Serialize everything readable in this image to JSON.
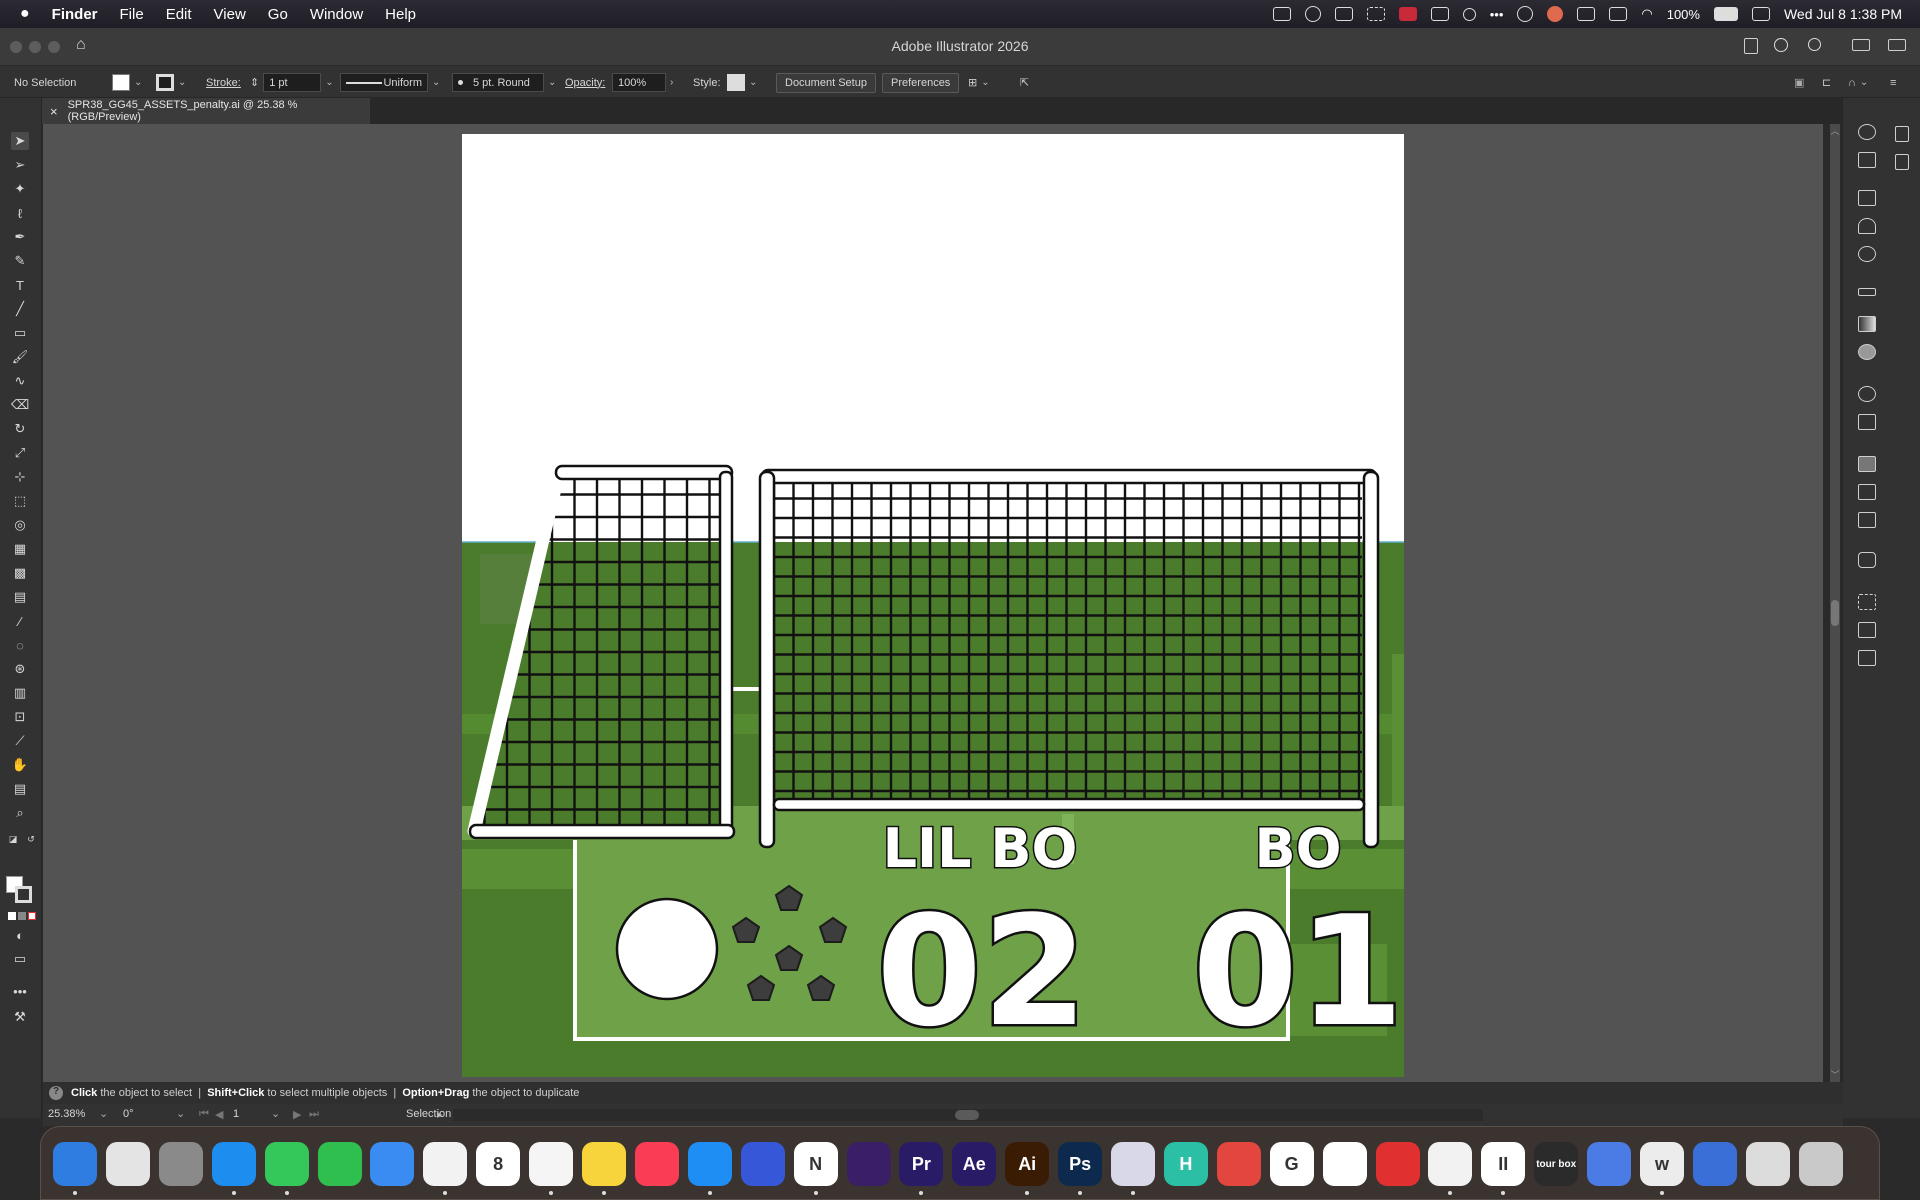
{
  "menubar": {
    "apple": "",
    "items": [
      "Finder",
      "File",
      "Edit",
      "View",
      "Go",
      "Window",
      "Help"
    ],
    "battery": "100%",
    "clock": "Wed Jul 8  1:38 PM"
  },
  "titlebar": {
    "title": "Adobe Illustrator 2026"
  },
  "controlbar": {
    "selection": "No Selection",
    "stroke_label": "Stroke:",
    "stroke_value": "1 pt",
    "profile": "Uniform",
    "brush": "5 pt. Round",
    "opacity_label": "Opacity:",
    "opacity_value": "100%",
    "style_label": "Style:",
    "document_setup": "Document Setup",
    "preferences": "Preferences"
  },
  "document": {
    "tab_title": "SPR38_GG45_ASSETS_penalty.ai @ 25.38 % (RGB/Preview)",
    "close": "×"
  },
  "artwork": {
    "team_left": "LIL BO",
    "team_right": "BO",
    "score_left": "02",
    "score_right": "01",
    "colors": {
      "field_dark": "#4a7c2c",
      "field_mid": "#5b8f36",
      "field_light": "#6fa149",
      "net_line": "#111111"
    }
  },
  "hint": {
    "a_key": "Click",
    "a_text": "the object to select",
    "b_key": "Shift+Click",
    "b_text": "to select multiple objects",
    "c_key": "Option+Drag",
    "c_text": "the object to duplicate",
    "sep": "|"
  },
  "statusbar": {
    "zoom": "25.38%",
    "rotation": "0°",
    "artboard": "1",
    "tool": "Selection"
  },
  "dock": {
    "apps": [
      {
        "name": "finder",
        "label": "",
        "color": "#2f7de0"
      },
      {
        "name": "launchpad",
        "label": "",
        "color": "#e4e4e4"
      },
      {
        "name": "system-settings",
        "label": "",
        "color": "#8a8a8a"
      },
      {
        "name": "safari",
        "label": "",
        "color": "#1d8df0"
      },
      {
        "name": "messages",
        "label": "",
        "color": "#34c759"
      },
      {
        "name": "facetime",
        "label": "",
        "color": "#2fbf4f"
      },
      {
        "name": "mail",
        "label": "",
        "color": "#3b8cf2"
      },
      {
        "name": "photos",
        "label": "",
        "color": "#f2f2f2"
      },
      {
        "name": "calendar",
        "label": "8",
        "color": "#ffffff"
      },
      {
        "name": "reminders",
        "label": "",
        "color": "#f5f5f5"
      },
      {
        "name": "notes",
        "label": "",
        "color": "#f7d43b"
      },
      {
        "name": "music",
        "label": "",
        "color": "#fb3c55"
      },
      {
        "name": "app-store",
        "label": "",
        "color": "#1e8ef5"
      },
      {
        "name": "omnifocus",
        "label": "",
        "color": "#3657d8"
      },
      {
        "name": "notion",
        "label": "N",
        "color": "#ffffff"
      },
      {
        "name": "activity",
        "label": "",
        "color": "#3a1f66"
      },
      {
        "name": "premiere",
        "label": "Pr",
        "color": "#2a1b66"
      },
      {
        "name": "after-effects",
        "label": "Ae",
        "color": "#2a1b66"
      },
      {
        "name": "illustrator",
        "label": "Ai",
        "color": "#3a1c04"
      },
      {
        "name": "photoshop",
        "label": "Ps",
        "color": "#0d2a4e"
      },
      {
        "name": "preview",
        "label": "",
        "color": "#d8d8e8"
      },
      {
        "name": "h-app",
        "label": "H",
        "color": "#2bbfa5"
      },
      {
        "name": "pie-app",
        "label": "",
        "color": "#e2463f"
      },
      {
        "name": "google",
        "label": "G",
        "color": "#ffffff"
      },
      {
        "name": "freeform",
        "label": "",
        "color": "#ffffff"
      },
      {
        "name": "youtube",
        "label": "",
        "color": "#e03030"
      },
      {
        "name": "perplexity",
        "label": "",
        "color": "#f2f2f2"
      },
      {
        "name": "pause-app",
        "label": "II",
        "color": "#ffffff"
      },
      {
        "name": "tourbox",
        "label": "tour box",
        "color": "#2b2b2b"
      },
      {
        "name": "files-app",
        "label": "",
        "color": "#4b7be5"
      },
      {
        "name": "w-app",
        "label": "w",
        "color": "#ececec"
      },
      {
        "name": "storage-app",
        "label": "",
        "color": "#3a6fd8"
      },
      {
        "name": "downloads-stack",
        "label": "",
        "color": "#dcdcdc"
      },
      {
        "name": "trash",
        "label": "",
        "color": "#c9c9c9"
      }
    ]
  }
}
